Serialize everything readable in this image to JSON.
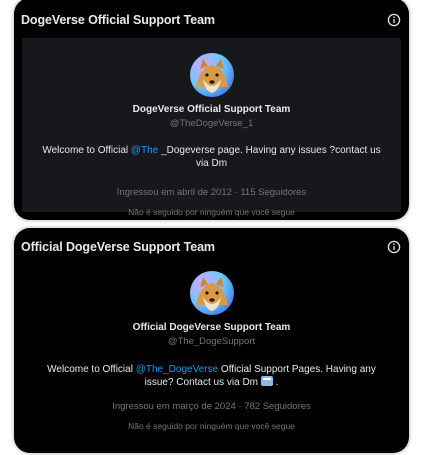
{
  "cards": [
    {
      "header_title": "DogeVerse Official Support Team",
      "name": "DogeVerse Official Support Team",
      "handle": "@TheDogeVerse_1",
      "bio": {
        "before": "Welcome to Official ",
        "mention": "@The",
        "after": " _Dogeverse page. Having any issues ?contact us via Dm"
      },
      "joined": "Ingressou em abril de 2012 · 115 Seguidores",
      "followed_by": "Não é seguido por ninguém que você segue"
    },
    {
      "header_title": "Official DogeVerse Support Team",
      "name": "Official DogeVerse Support Team",
      "handle": "@The_DogeSupport",
      "bio": {
        "before": "Welcome to Official ",
        "mention": "@The_DogeVerse",
        "after": " Official Support Pages. Having any issue? Contact us via Dm ",
        "emoji_icon": "mailbox-icon",
        "end": " ."
      },
      "joined": "Ingressou em março de 2024 · 782 Seguidores",
      "followed_by": "Não é seguido por ninguém que você segue"
    }
  ],
  "colors": {
    "card_bg": "#000000",
    "inner_bg": "#16181c",
    "text_primary": "#e7e9ea",
    "text_secondary": "#71767b",
    "mention": "#1d9bf0"
  },
  "icons": {
    "header_icon": "info-icon",
    "avatar": "doge-avatar"
  }
}
